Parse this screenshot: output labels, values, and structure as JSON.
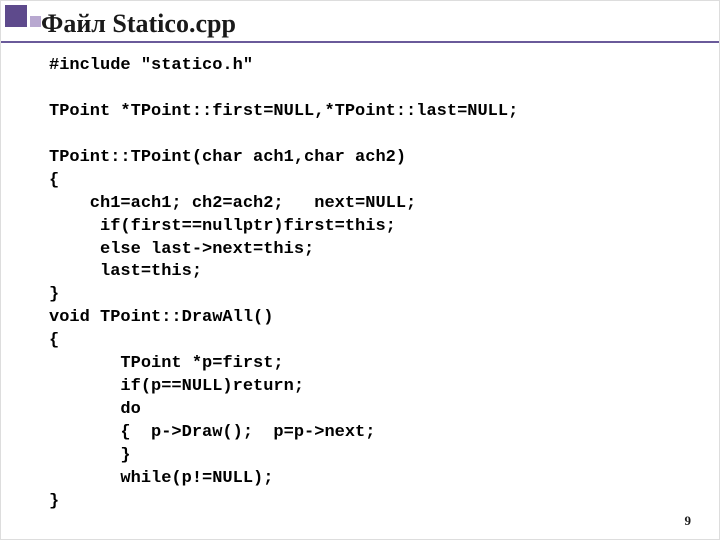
{
  "title": "Файл Statico.cpp",
  "pageNumber": "9",
  "code": {
    "l1": "#include \"statico.h\"",
    "l2": "",
    "l3": "TPoint *TPoint::first=NULL,*TPoint::last=NULL;",
    "l4": "",
    "l5": "TPoint::TPoint(char ach1,char ach2)",
    "l6": "{",
    "l7": "    ch1=ach1; ch2=ach2;   next=NULL;",
    "l8": "     if(first==nullptr)first=this;",
    "l9": "     else last->next=this;",
    "l10": "     last=this;",
    "l11": "}",
    "l12": "void TPoint::DrawAll()",
    "l13": "{",
    "l14": "       TPoint *p=first;",
    "l15": "       if(p==NULL)return;",
    "l16": "       do",
    "l17": "       {  p->Draw();  p=p->next;",
    "l18": "       }",
    "l19": "       while(p!=NULL);",
    "l20": "}"
  }
}
